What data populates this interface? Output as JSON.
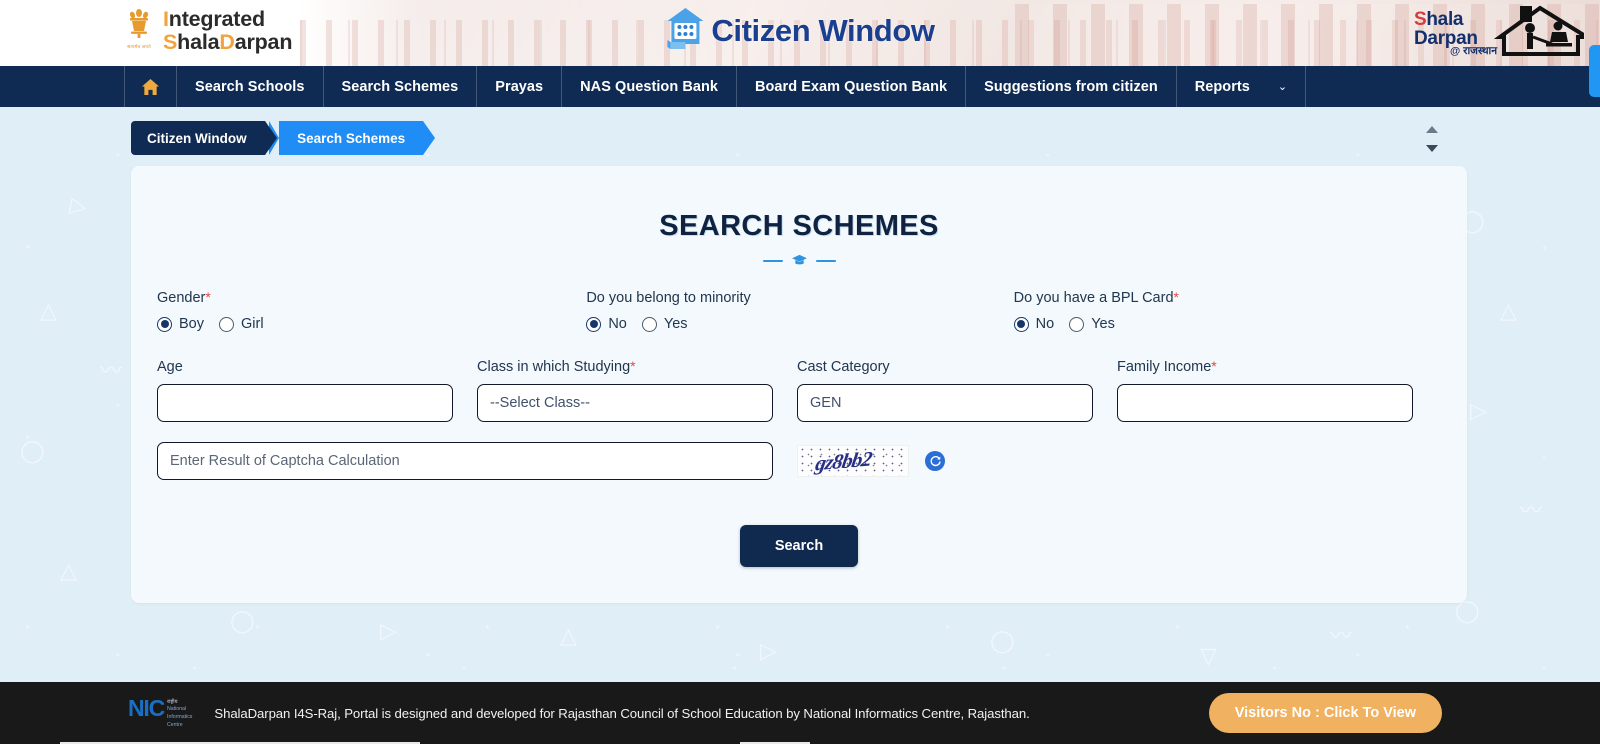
{
  "header": {
    "left_logo": {
      "line1": "Integrated",
      "line2": "ShalaDarpan",
      "emblem_caption": "सत्यमेव जयते",
      "icon": "national-emblem-icon"
    },
    "center_logo": {
      "text": "Citizen Window",
      "icon": "house-window-icon"
    },
    "right_logo": {
      "line1_a": "Shala",
      "line2_a": "Darpan",
      "hindi": "@ राजस्थान",
      "icon": "shala-darpan-house-icon"
    }
  },
  "nav": {
    "home_icon": "home-icon",
    "items": [
      {
        "label": "Search Schools"
      },
      {
        "label": "Search Schemes"
      },
      {
        "label": "Prayas"
      },
      {
        "label": "NAS Question Bank"
      },
      {
        "label": "Board Exam Question Bank"
      },
      {
        "label": "Suggestions from citizen"
      },
      {
        "label": "Reports",
        "caret": "⌄"
      }
    ]
  },
  "breadcrumb": {
    "items": [
      {
        "label": "Citizen Window",
        "active": false
      },
      {
        "label": "Search Schemes",
        "active": true
      }
    ]
  },
  "page": {
    "title": "SEARCH SCHEMES",
    "divider_icon": "graduation-cap-icon"
  },
  "form": {
    "radio_groups": [
      {
        "label": "Gender",
        "required": "*",
        "options": [
          {
            "label": "Boy",
            "selected": true
          },
          {
            "label": "Girl",
            "selected": false
          }
        ]
      },
      {
        "label": "Do you belong to minority",
        "required": "",
        "options": [
          {
            "label": "No",
            "selected": true
          },
          {
            "label": "Yes",
            "selected": false
          }
        ]
      },
      {
        "label": "Do you have a BPL Card",
        "required": "*",
        "options": [
          {
            "label": "No",
            "selected": true
          },
          {
            "label": "Yes",
            "selected": false
          }
        ]
      }
    ],
    "fields": [
      {
        "label": "Age",
        "required": "",
        "value": "",
        "placeholder": "",
        "type": "text"
      },
      {
        "label": "Class in which Studying",
        "required": "*",
        "value": "--Select Class--",
        "placeholder": "",
        "type": "select"
      },
      {
        "label": "Cast Category",
        "required": "",
        "value": "GEN",
        "placeholder": "",
        "type": "select"
      },
      {
        "label": "Family Income",
        "required": "*",
        "value": "",
        "placeholder": "",
        "type": "text"
      }
    ],
    "captcha": {
      "placeholder": "Enter Result of Captcha Calculation",
      "value": "",
      "image_text": "gz8bb2",
      "refresh_icon": "refresh-icon"
    },
    "search_button": "Search"
  },
  "footer": {
    "nic_logo": {
      "abbr": "NIC",
      "hindi": "राष्ट्रीय",
      "line1": "National",
      "line2": "Informatics",
      "line3": "Centre"
    },
    "text": "ShalaDarpan I4S-Raj, Portal is designed and developed for Rajasthan Council of School Education by National Informatics Centre, Rajasthan.",
    "visitors_button": "Visitors No : Click To View"
  },
  "colors": {
    "navy": "#0f2b53",
    "accent_blue": "#1f8df5",
    "orange": "#f2a33c",
    "required_red": "#e8443c",
    "page_bg": "#e0eef7",
    "card_bg": "#f3f9fd",
    "footer_bg": "#191919",
    "visitors_bg": "#f0b160"
  }
}
